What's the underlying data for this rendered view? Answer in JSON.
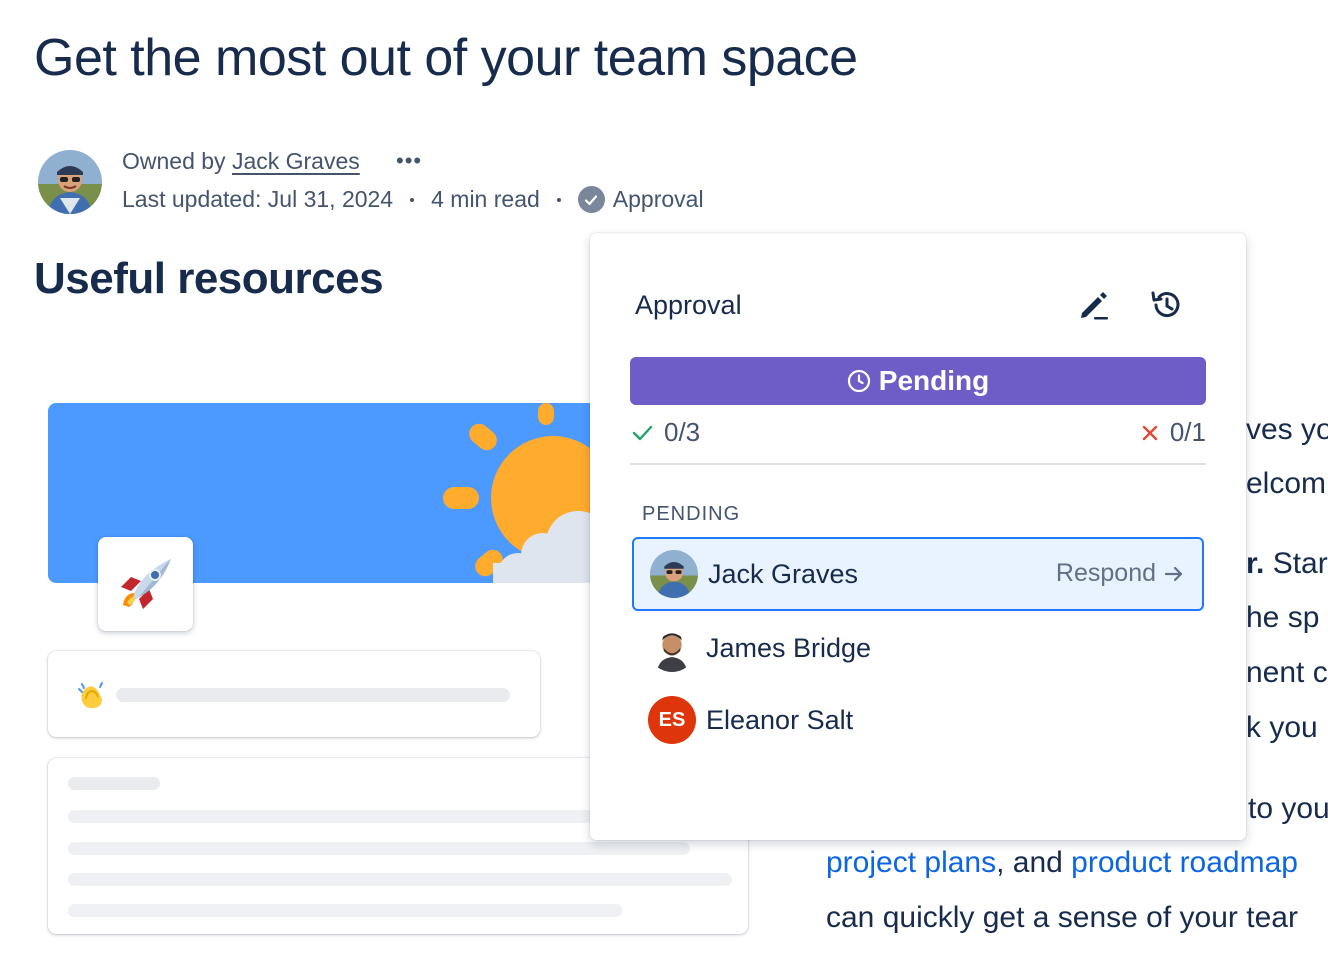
{
  "page": {
    "title": "Get the most out of your team space",
    "owner_prefix": "Owned by",
    "owner_name": "Jack Graves",
    "more_label": "•••",
    "last_updated": "Last updated: Jul 31, 2024",
    "read_time": "4 min read",
    "approval_label": "Approval",
    "section_heading": "Useful resources"
  },
  "body_text": {
    "line1": "ves yo",
    "line2": "elcomi",
    "line3_bold": "r.",
    "line3_rest": " Star",
    "line4": "he sp",
    "line5": "nent c",
    "line6": "k you",
    "line7": "to you",
    "line8_link1": "project plans",
    "line8_mid": ", and ",
    "line8_link2": "product roadmap",
    "line9": "can quickly get a sense of your tear"
  },
  "popover": {
    "title": "Approval",
    "edit_icon": "pencil-icon",
    "history_icon": "history-icon",
    "status": "Pending",
    "approved_count": "0/3",
    "rejected_count": "0/1",
    "section_label": "PENDING",
    "reviewers": [
      {
        "name": "Jack Graves",
        "action": "Respond"
      },
      {
        "name": "James Bridge"
      },
      {
        "name": "Eleanor Salt",
        "initials": "ES"
      }
    ]
  },
  "colors": {
    "pending": "#6e5dc6",
    "selected_row": "#e9f2ff",
    "selected_border": "#1d7afc",
    "banner": "#4c9aff",
    "sun": "#ffab2e",
    "link": "#0c66e4",
    "initials_avatar": "#de350b"
  }
}
